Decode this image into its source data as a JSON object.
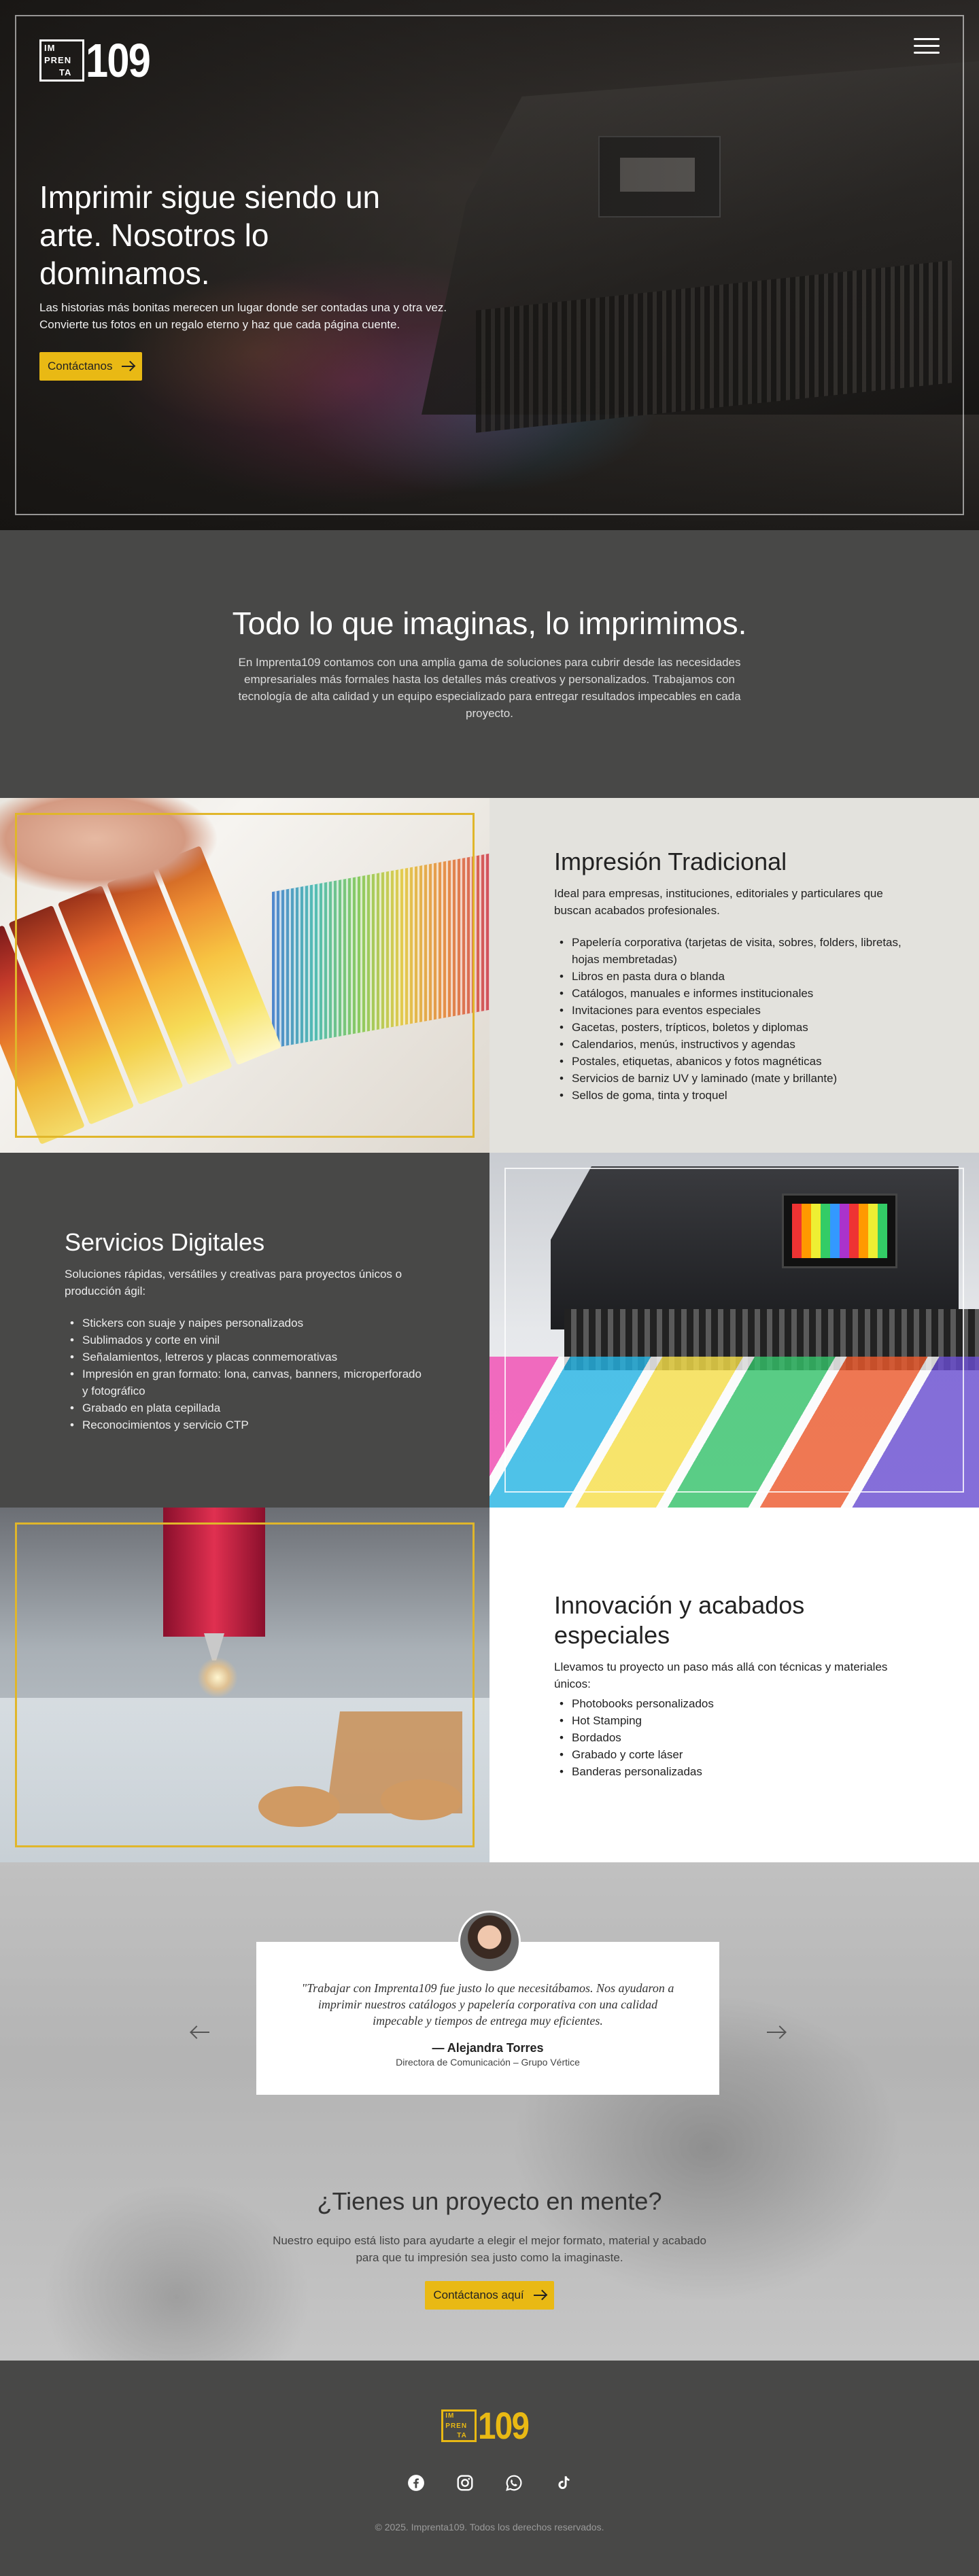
{
  "brand": {
    "logo_line1": "IM",
    "logo_line2": "PREN",
    "logo_line3": "TA",
    "logo_number": "109",
    "accent": "#e9b914"
  },
  "hero": {
    "title": "Imprimir sigue siendo un arte. Nosotros lo dominamos.",
    "text": "Las historias más bonitas merecen un lugar donde ser contadas una y otra vez. Convierte tus fotos en un regalo eterno y haz que cada página cuente.",
    "cta_label": "Contáctanos"
  },
  "intro": {
    "title": "Todo lo que imaginas, lo imprimimos.",
    "text": "En Imprenta109 contamos con una amplia gama de soluciones para cubrir desde las necesidades empresariales más formales hasta los detalles más creativos y personalizados. Trabajamos con tecnología de alta calidad y un equipo especializado para entregar resultados impecables en cada proyecto."
  },
  "services": [
    {
      "title": "Impresión Tradicional",
      "text": "Ideal para empresas, instituciones, editoriales y particulares que buscan acabados profesionales.",
      "items": [
        "Papelería corporativa (tarjetas de visita, sobres, folders, libretas, hojas membretadas)",
        "Libros en pasta dura o blanda",
        "Catálogos, manuales e informes institucionales",
        "Invitaciones para eventos especiales",
        "Gacetas, posters, trípticos, boletos y diplomas",
        "Calendarios, menús, instructivos y agendas",
        "Postales, etiquetas, abanicos y fotos magnéticas",
        "Servicios de barniz UV y laminado (mate y brillante)",
        "Sellos de goma, tinta y troquel"
      ]
    },
    {
      "title": "Servicios Digitales",
      "text": "Soluciones rápidas, versátiles y creativas para proyectos únicos o producción ágil:",
      "items": [
        "Stickers con suaje y naipes personalizados",
        "Sublimados y corte en vinil",
        "Señalamientos, letreros y placas conmemorativas",
        "Impresión en gran formato: lona, canvas, banners, microperforado y fotográfico",
        "Grabado en plata cepillada",
        "Reconocimientos y servicio CTP"
      ]
    },
    {
      "title": "Innovación y acabados especiales",
      "text": "Llevamos tu proyecto un paso más allá con técnicas y materiales únicos:",
      "items": [
        "Photobooks personalizados",
        "Hot Stamping",
        "Bordados",
        "Grabado y corte láser",
        "Banderas personalizadas"
      ]
    }
  ],
  "testimonial": {
    "quote": "\"Trabajar con Imprenta109 fue justo lo que necesitábamos. Nos ayudaron a imprimir nuestros catálogos y papelería corporativa con una calidad impecable y tiempos de entrega muy eficientes.",
    "name": "— Alejandra Torres",
    "role": "Directora de Comunicación – Grupo Vértice"
  },
  "cta": {
    "title": "¿Tienes un proyecto en mente?",
    "text": "Nuestro equipo está listo para ayudarte a elegir el mejor formato, material y acabado para que tu impresión sea justo como la imaginaste.",
    "button_label": "Contáctanos aquí"
  },
  "footer": {
    "socials": [
      "facebook-icon",
      "instagram-icon",
      "whatsapp-icon",
      "tiktok-icon"
    ],
    "copyright": "© 2025. Imprenta109. Todos los derechos reservados."
  }
}
